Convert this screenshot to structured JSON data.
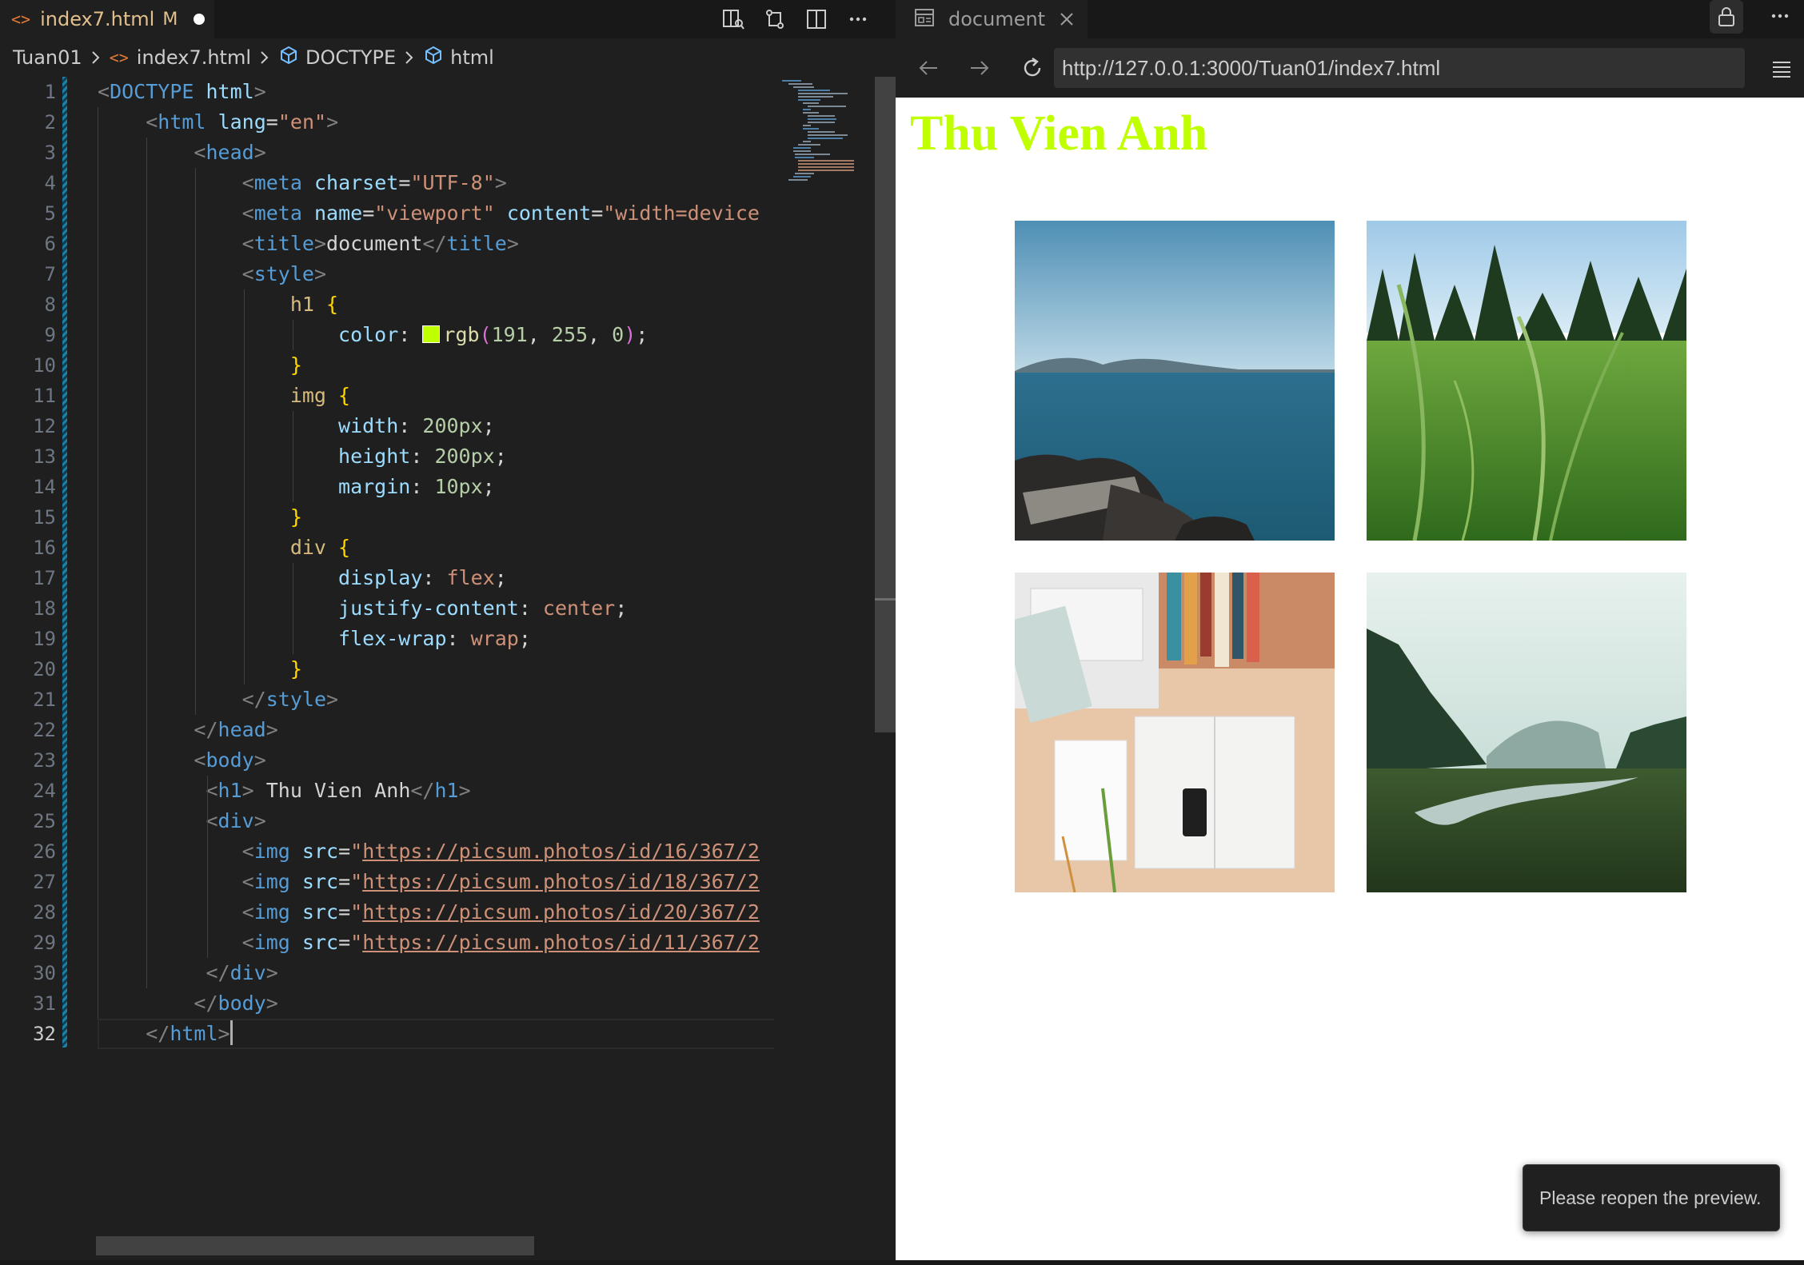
{
  "editor": {
    "tab": {
      "filename": "index7.html",
      "status": "M"
    },
    "breadcrumb": {
      "folder": "Tuan01",
      "file": "index7.html",
      "symbol1": "DOCTYPE",
      "symbol2": "html"
    },
    "active_line": 32,
    "line_numbers": [
      "1",
      "2",
      "3",
      "4",
      "5",
      "6",
      "7",
      "8",
      "9",
      "10",
      "11",
      "12",
      "13",
      "14",
      "15",
      "16",
      "17",
      "18",
      "19",
      "20",
      "21",
      "22",
      "23",
      "24",
      "25",
      "26",
      "27",
      "28",
      "29",
      "30",
      "31",
      "32"
    ],
    "color_swatch": "#bfff00",
    "colors": {
      "accent": "#1b81a8",
      "modified": "#e2c08d",
      "html_icon": "#e37933"
    }
  },
  "browser": {
    "tab_title": "document",
    "url": "http://127.0.0.1:3000/Tuan01/index7.html",
    "page": {
      "heading": "Thu Vien Anh",
      "heading_color": "rgb(191, 255, 0)",
      "images": [
        "lake-with-rocks-photo",
        "grass-field-photo",
        "desk-with-laptop-photo",
        "misty-valley-river-photo"
      ]
    }
  },
  "toast": {
    "message": "Please reopen the preview."
  }
}
